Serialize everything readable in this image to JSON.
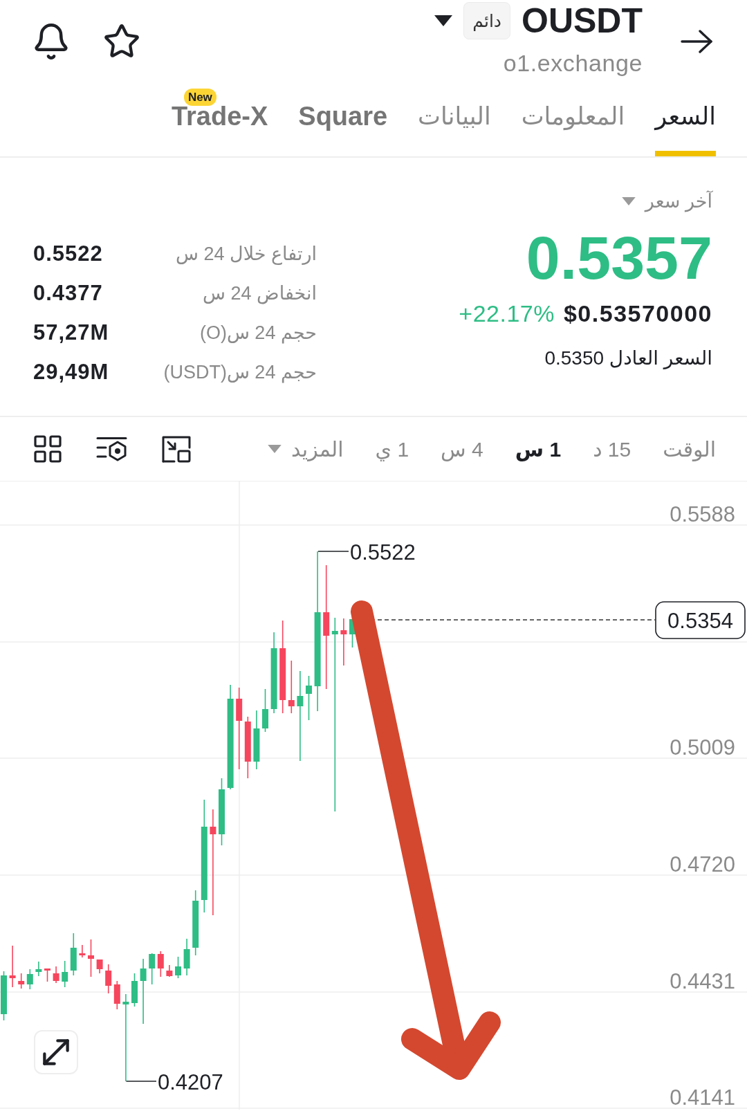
{
  "header": {
    "title": "OUSDT",
    "badge": "دائم",
    "subtitle": "o1.exchange"
  },
  "tabs": [
    {
      "label": "السعر",
      "selected": true,
      "kind": "section"
    },
    {
      "label": "المعلومات",
      "selected": false,
      "kind": "section"
    },
    {
      "label": "البيانات",
      "selected": false,
      "kind": "section"
    },
    {
      "label": "Square",
      "selected": false,
      "kind": "feature"
    },
    {
      "label": "Trade-X",
      "selected": false,
      "kind": "feature",
      "badge": "New"
    }
  ],
  "price": {
    "label": "آخر سعر",
    "last": "0.5357",
    "change": "+22.17%",
    "usd": "$0.53570000",
    "fair_price": "السعر العادل 0.5350"
  },
  "stats": [
    {
      "label": "ارتفاع خلال 24 س",
      "value": "0.5522"
    },
    {
      "label": "انخفاض 24 س",
      "value": "0.4377"
    },
    {
      "label": "حجم 24 س(O)",
      "value": "57,27M"
    },
    {
      "label": "حجم 24 س(USDT)",
      "value": "29,49M"
    }
  ],
  "toolbar": {
    "label": "الوقت",
    "intervals": [
      {
        "label": "15 د",
        "selected": false
      },
      {
        "label": "1 س",
        "selected": true
      },
      {
        "label": "4 س",
        "selected": false
      },
      {
        "label": "1 ي",
        "selected": false
      }
    ],
    "more": "المزيد"
  },
  "chart": {
    "axis_labels": [
      "0.5588",
      "0.5009",
      "0.4720",
      "0.4431",
      "0.4141"
    ],
    "high_label": "0.5522",
    "low_label": "0.4207",
    "last_price_tag": "0.5354"
  }
}
